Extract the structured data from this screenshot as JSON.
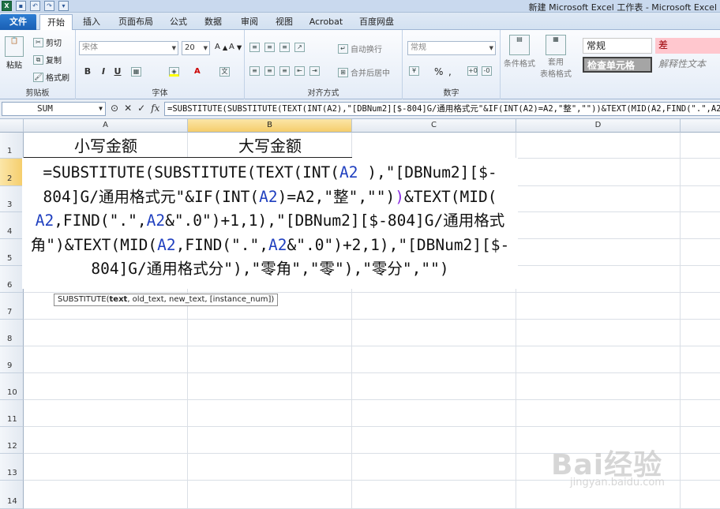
{
  "titlebar": {
    "title": "新建 Microsoft Excel 工作表 - Microsoft Excel"
  },
  "tabs": [
    "文件",
    "开始",
    "插入",
    "页面布局",
    "公式",
    "数据",
    "审阅",
    "视图",
    "Acrobat",
    "百度网盘"
  ],
  "ribbon": {
    "clipboard": {
      "paste": "粘贴",
      "cut": "剪切",
      "copy": "复制",
      "format_painter": "格式刷",
      "label": "剪贴板"
    },
    "font": {
      "font_name": "宋体",
      "font_size": "20",
      "bold": "B",
      "italic": "I",
      "underline": "U",
      "label": "字体"
    },
    "alignment": {
      "wrap": "自动换行",
      "merge": "合并后居中",
      "label": "对齐方式"
    },
    "number": {
      "format": "常规",
      "percent": "%",
      "comma": ",",
      "label": "数字"
    },
    "styles": {
      "conditional": "条件格式",
      "table_format_1": "套用",
      "table_format_2": "表格格式",
      "normal": "常规",
      "bad": "差",
      "check_cell": "检查单元格",
      "explanatory": "解释性文本"
    }
  },
  "formula_bar": {
    "name_box": "SUM",
    "cancel": "✕",
    "enter": "✓",
    "fx": "fx",
    "formula": "=SUBSTITUTE(SUBSTITUTE(TEXT(INT(A2),\"[DBNum2][$-804]G/通用格式元\"&IF(INT(A2)=A2,\"整\",\"\"))&TEXT(MID(A2,FIND(\".\",A2&\".0\")+1,1),\"[DBNum2][$-804]G/通用格式角\")&TEXT(MID(A2,FIND(\".\",A2&\".0\")+2,1),\"[DBNum2][$-804]G/通用格式分\"),\"零角\",\"零\"),\"零分\",\"\")"
  },
  "columns": [
    "A",
    "B",
    "C",
    "D"
  ],
  "rows": [
    "1",
    "2",
    "3",
    "4",
    "5",
    "6",
    "7",
    "8",
    "9",
    "10",
    "11",
    "12",
    "13",
    "14"
  ],
  "cells": {
    "A1": "小写金额",
    "B1": "大写金额"
  },
  "edit_lines": [
    [
      [
        "t",
        "=SUBSTITUTE(SUBSTITUTE(TEXT(INT("
      ],
      [
        "b",
        "A2"
      ],
      [
        "t",
        " ),\"[DBNum2][$-"
      ]
    ],
    [
      [
        "t",
        "804]G/通用格式元\"&IF(INT("
      ],
      [
        "b",
        "A2"
      ],
      [
        "t",
        ")=A2,\"整\",\"\")"
      ],
      [
        "p",
        ")"
      ],
      [
        "t",
        "&TEXT(MID("
      ]
    ],
    [
      [
        "b",
        "A2"
      ],
      [
        "t",
        ",FIND(\".\","
      ],
      [
        "b",
        "A2"
      ],
      [
        "t",
        "&\".0\")+1,1),\"[DBNum2][$-804]G/通用格式"
      ]
    ],
    [
      [
        "t",
        "角\")&TEXT(MID("
      ],
      [
        "b",
        "A2"
      ],
      [
        "t",
        ",FIND(\".\","
      ],
      [
        "b",
        "A2"
      ],
      [
        "t",
        "&\".0\")+2,1),\"[DBNum2][$-"
      ]
    ],
    [
      [
        "t",
        "804]G/通用格式分\")"
      ],
      [
        "t",
        ",\"零角\",\"零\")"
      ],
      [
        "t",
        ",\"零分\",\"\")"
      ]
    ]
  ],
  "tooltip": {
    "fn": "SUBSTITUTE(",
    "arg1": "text",
    "rest": ", old_text, new_text, [instance_num])"
  },
  "watermark": {
    "main": "Bai经验",
    "sub": "jingyan.baidu.com"
  }
}
